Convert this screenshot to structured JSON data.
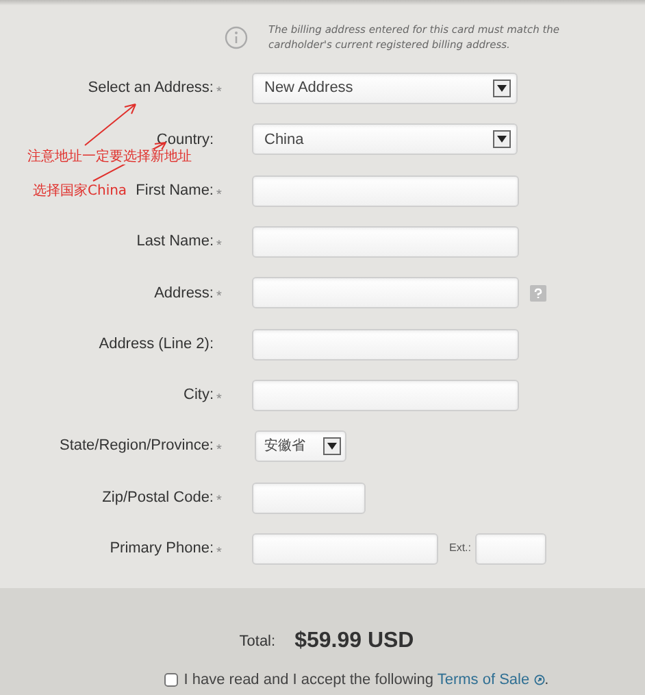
{
  "notice": "The billing address entered for this card must match the cardholder's current registered billing address.",
  "fields": [
    {
      "label": "Select an Address:",
      "asterisk": "*",
      "kind": "select",
      "value": "New Address"
    },
    {
      "label": "Country:",
      "kind": "select",
      "value": "China"
    },
    {
      "label": "First Name:",
      "asterisk": "*",
      "kind": "text"
    },
    {
      "label": "Last Name:",
      "asterisk": "*",
      "kind": "text"
    },
    {
      "label": "Address:",
      "asterisk": "*",
      "kind": "text",
      "help": true
    },
    {
      "label": "Address (Line 2):",
      "kind": "text"
    },
    {
      "label": "City:",
      "asterisk": "*",
      "kind": "text"
    },
    {
      "label": "State/Region/Province:",
      "asterisk": "*",
      "kind": "select-short",
      "value": "安徽省"
    },
    {
      "label": "Zip/Postal Code:",
      "asterisk": "*",
      "kind": "text-short"
    },
    {
      "label": "Primary Phone:",
      "asterisk": "*",
      "kind": "phone",
      "ext_label": "Ext.:"
    }
  ],
  "annotations": [
    "注意地址一定要选择新地址",
    "选择国家China"
  ],
  "total": {
    "label": "Total:",
    "amount": "$59.99 USD"
  },
  "terms": {
    "checked": false,
    "text": "I have read and I accept the following",
    "link": "Terms of Sale",
    "end": "."
  }
}
